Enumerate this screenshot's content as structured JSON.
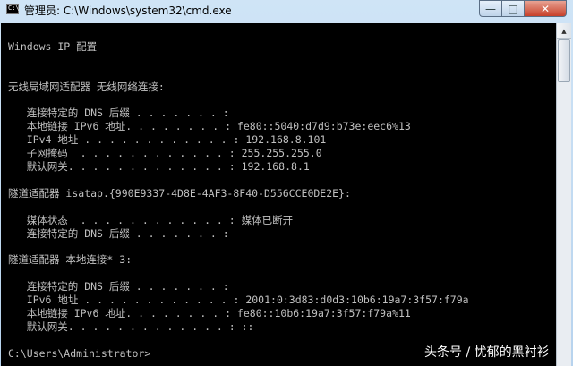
{
  "window": {
    "title": "管理员: C:\\Windows\\system32\\cmd.exe",
    "icon_label": "C:\\",
    "minimize_glyph": "—",
    "maximize_glyph": "□",
    "close_glyph": "✕"
  },
  "console": {
    "lines": [
      "",
      "Windows IP 配置",
      "",
      "",
      "无线局域网适配器 无线网络连接:",
      "",
      "   连接特定的 DNS 后缀 . . . . . . . :",
      "   本地链接 IPv6 地址. . . . . . . . : fe80::5040:d7d9:b73e:eec6%13",
      "   IPv4 地址 . . . . . . . . . . . . : 192.168.8.101",
      "   子网掩码  . . . . . . . . . . . . : 255.255.255.0",
      "   默认网关. . . . . . . . . . . . . : 192.168.8.1",
      "",
      "隧道适配器 isatap.{990E9337-4D8E-4AF3-8F40-D556CCE0DE2E}:",
      "",
      "   媒体状态  . . . . . . . . . . . . : 媒体已断开",
      "   连接特定的 DNS 后缀 . . . . . . . :",
      "",
      "隧道适配器 本地连接* 3:",
      "",
      "   连接特定的 DNS 后缀 . . . . . . . :",
      "   IPv6 地址 . . . . . . . . . . . . : 2001:0:3d83:d0d3:10b6:19a7:3f57:f79a",
      "   本地链接 IPv6 地址. . . . . . . . : fe80::10b6:19a7:3f57:f79a%11",
      "   默认网关. . . . . . . . . . . . . : ::",
      "",
      "C:\\Users\\Administrator>"
    ]
  },
  "watermark": "头条号 / 忧郁的黑衬衫"
}
